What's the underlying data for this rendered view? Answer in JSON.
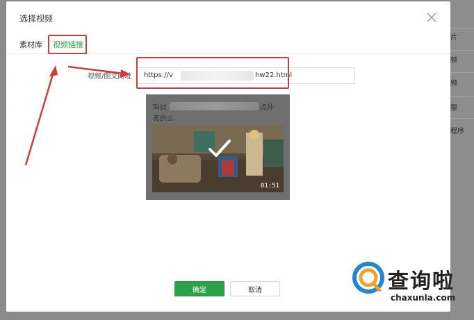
{
  "background_panel": {
    "right_items": [
      "片",
      "频",
      "频",
      "票",
      "程序"
    ]
  },
  "dialog": {
    "title": "选择视频",
    "tabs": [
      {
        "label": "素材库",
        "active": false
      },
      {
        "label": "视频链接",
        "active": true
      }
    ],
    "url_field": {
      "label": "视频/图文网址",
      "value_prefix": "https://v",
      "value_suffix": "hw22.html"
    },
    "video_card": {
      "title_line1_prefix": "叫过",
      "title_line1_suffix": "点外",
      "title_line2": "卖的么",
      "duration": "01:51",
      "selected": true
    },
    "buttons": {
      "confirm": "确定",
      "cancel": "取消"
    }
  },
  "watermark": {
    "brand": "查询啦",
    "domain": "chaxunla.com"
  },
  "colors": {
    "accent_green": "#2fa04a",
    "annotation_red": "#d03b3b"
  }
}
